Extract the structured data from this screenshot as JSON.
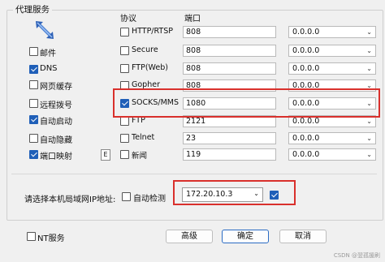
{
  "group": {
    "title": "代理服务"
  },
  "headers": {
    "protocol": "协议",
    "port": "端口"
  },
  "left_options": [
    {
      "label": "邮件",
      "checked": false
    },
    {
      "label": "DNS",
      "checked": true
    },
    {
      "label": "网页缓存",
      "checked": false
    },
    {
      "label": "远程拨号",
      "checked": false
    },
    {
      "label": "自动启动",
      "checked": true
    },
    {
      "label": "自动隐藏",
      "checked": false
    },
    {
      "label": "端口映射",
      "checked": true
    }
  ],
  "e_button": "E",
  "protocols": [
    {
      "label": "HTTP/RTSP",
      "checked": false,
      "port": "808",
      "ip": "0.0.0.0"
    },
    {
      "label": "Secure",
      "checked": false,
      "port": "808",
      "ip": "0.0.0.0"
    },
    {
      "label": "FTP(Web)",
      "checked": false,
      "port": "808",
      "ip": "0.0.0.0"
    },
    {
      "label": "Gopher",
      "checked": false,
      "port": "808",
      "ip": "0.0.0.0"
    },
    {
      "label": "SOCKS/MMS",
      "checked": true,
      "port": "1080",
      "ip": "0.0.0.0"
    },
    {
      "label": "FTP",
      "checked": false,
      "port": "2121",
      "ip": "0.0.0.0"
    },
    {
      "label": "Telnet",
      "checked": false,
      "port": "23",
      "ip": "0.0.0.0"
    },
    {
      "label": "新闻",
      "checked": false,
      "port": "119",
      "ip": "0.0.0.0"
    }
  ],
  "lan": {
    "label": "请选择本机局域网IP地址:",
    "auto_label": "自动检测",
    "auto_checked": false,
    "ip": "172.20.10.3",
    "confirm_checked": true
  },
  "nt": {
    "label": "NT服务",
    "checked": false
  },
  "buttons": {
    "advanced": "高级",
    "ok": "确定",
    "cancel": "取消"
  },
  "watermark": "CSDN @翌孤援刷",
  "colors": {
    "highlight": "#d9302c",
    "accent": "#1f5fb8"
  }
}
